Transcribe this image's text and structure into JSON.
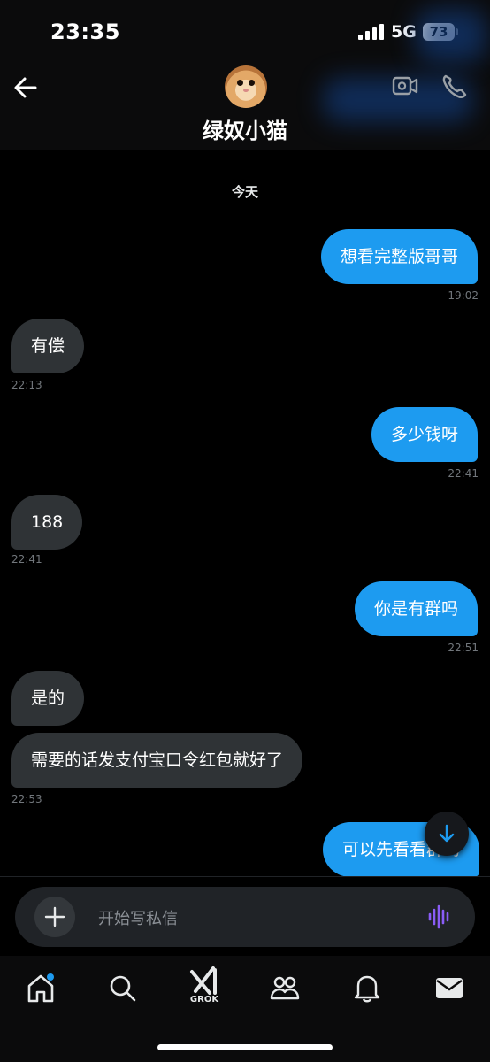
{
  "status": {
    "time": "23:35",
    "network": "5G",
    "battery": "73"
  },
  "header": {
    "contact_name": "绿奴小猫",
    "back_icon": "arrow-left-icon",
    "video_icon": "video-call-icon",
    "phone_icon": "phone-icon"
  },
  "conversation": {
    "day_label": "今天",
    "messages": [
      {
        "direction": "out",
        "text": "想看完整版哥哥",
        "time": "19:02"
      },
      {
        "direction": "in",
        "text": "有偿",
        "time": "22:13"
      },
      {
        "direction": "out",
        "text": "多少钱呀",
        "time": "22:41"
      },
      {
        "direction": "in",
        "text": "188",
        "time": "22:41"
      },
      {
        "direction": "out",
        "text": "你是有群吗",
        "time": "22:51"
      },
      {
        "direction": "in",
        "text": "是的",
        "time": ""
      },
      {
        "direction": "in",
        "text": "需要的话发支付宝口令红包就好了",
        "time": "22:53"
      },
      {
        "direction": "out",
        "text": "可以先看看群吗",
        "time": ""
      }
    ]
  },
  "composer": {
    "placeholder": "开始写私信",
    "add_icon": "plus-icon",
    "voice_icon": "voice-wave-icon"
  },
  "tabbar": {
    "items": [
      {
        "icon": "home-icon",
        "label": "",
        "badge": true
      },
      {
        "icon": "search-icon",
        "label": ""
      },
      {
        "icon": "grok-icon",
        "label": "GROK"
      },
      {
        "icon": "communities-icon",
        "label": ""
      },
      {
        "icon": "bell-icon",
        "label": ""
      },
      {
        "icon": "mail-icon",
        "label": ""
      }
    ]
  },
  "colors": {
    "accent": "#1d9bf0",
    "incoming_bubble": "#2f3336",
    "background": "#000000",
    "voice": "#8a5cf6"
  }
}
